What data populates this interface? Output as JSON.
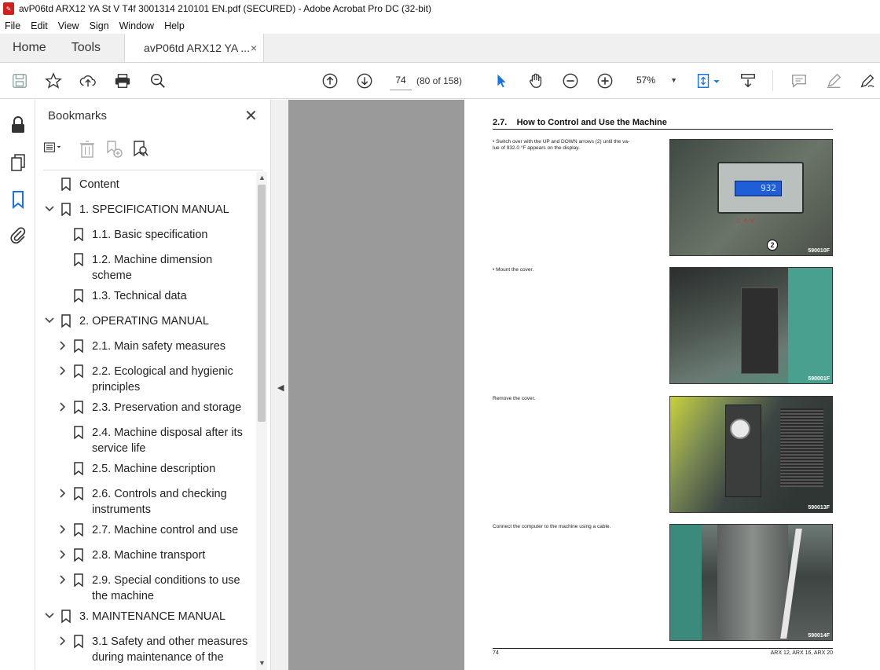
{
  "window": {
    "title": "avP06td ARX12 YA St V T4f 3001314 210101 EN.pdf (SECURED) - Adobe Acrobat Pro DC (32-bit)"
  },
  "menu": [
    "File",
    "Edit",
    "View",
    "Sign",
    "Window",
    "Help"
  ],
  "tabs": {
    "home": "Home",
    "tools": "Tools",
    "doc": "avP06td ARX12 YA ...",
    "doc_close": "×"
  },
  "toolbar": {
    "page_number": "74",
    "page_count": "(80 of 158)",
    "zoom": "57%"
  },
  "bookmarks": {
    "title": "Bookmarks",
    "items": [
      {
        "label": "Content",
        "expander": ""
      },
      {
        "label": "1. SPECIFICATION MANUAL",
        "expander": "expanded"
      },
      {
        "label": "1.1. Basic specification",
        "expander": ""
      },
      {
        "label": "1.2. Machine dimension",
        "label2": "scheme",
        "expander": ""
      },
      {
        "label": "1.3. Technical data",
        "expander": ""
      },
      {
        "label": "2. OPERATING MANUAL",
        "expander": "expanded"
      },
      {
        "label": "2.1. Main safety measures",
        "expander": "collapsed"
      },
      {
        "label": "2.2. Ecological and hygienic",
        "label2": "principles",
        "expander": "collapsed"
      },
      {
        "label": "2.3. Preservation and storage",
        "expander": "collapsed"
      },
      {
        "label": "2.4. Machine disposal after its",
        "label2": "service life",
        "expander": ""
      },
      {
        "label": "2.5. Machine description",
        "expander": ""
      },
      {
        "label": "2.6. Controls and checking",
        "label2": "instruments",
        "expander": "collapsed"
      },
      {
        "label": "2.7. Machine control and use",
        "expander": "collapsed"
      },
      {
        "label": "2.8. Machine transport",
        "expander": "collapsed"
      },
      {
        "label": "2.9. Special conditions to use",
        "label2": "the machine",
        "expander": "collapsed"
      },
      {
        "label": "3. MAINTENANCE MANUAL",
        "expander": "expanded"
      },
      {
        "label": "3.1 Safety and other measures",
        "label2": "during maintenance of the",
        "expander": "collapsed"
      }
    ]
  },
  "document": {
    "section_title": "2.7.    How to Control and Use the Machine",
    "steps": [
      {
        "text": "•     Switch over with the UP and DOWN arrows (2) until the va-\n       lue of 932.0 °F appears on the display.",
        "photo_caption": "590010F"
      },
      {
        "text": "•     Mount the cover.",
        "photo_caption": "590001F"
      },
      {
        "text": "Remove the cover.",
        "photo_caption": "590013F"
      },
      {
        "text": "Connect the computer to the machine using a cable.",
        "photo_caption": "590014F"
      }
    ],
    "display_value": "932",
    "callout": "2",
    "footer_left": "74",
    "footer_right": "ARX 12, ARX 16, ARX 20"
  }
}
